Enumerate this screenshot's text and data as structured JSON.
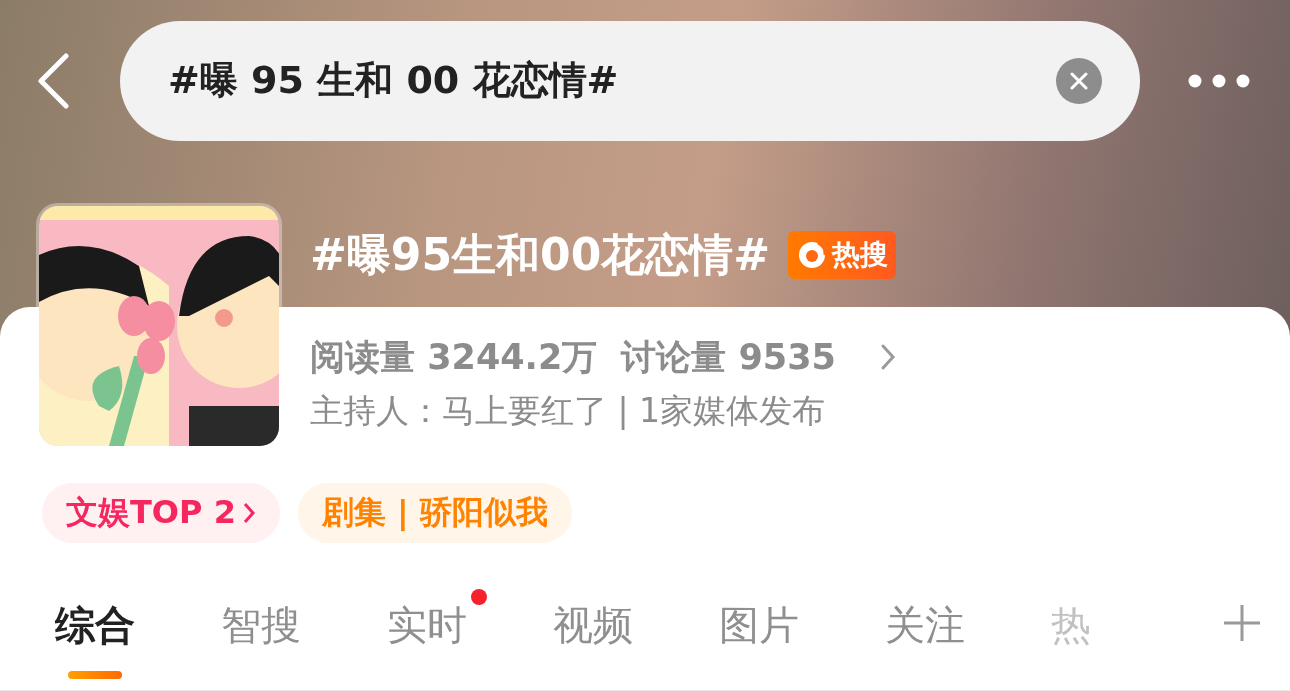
{
  "search": {
    "value": "#曝 95 生和 00 花恋情#"
  },
  "topic": {
    "title": "#曝95生和00花恋情#",
    "badge": "热搜"
  },
  "stats": [
    {
      "label": "阅读量",
      "value": "3244.2万"
    },
    {
      "label": "讨论量",
      "value": "9535"
    }
  ],
  "host_line": "主持人：马上要红了 | 1家媒体发布",
  "tags": [
    {
      "kind": "rank",
      "label": "文娱TOP 2"
    },
    {
      "kind": "category",
      "label": "剧集 | 骄阳似我"
    }
  ],
  "tabs": [
    {
      "label": "综合",
      "selected": true,
      "dot": false
    },
    {
      "label": "智搜",
      "selected": false,
      "dot": false
    },
    {
      "label": "实时",
      "selected": false,
      "dot": true
    },
    {
      "label": "视频",
      "selected": false,
      "dot": false
    },
    {
      "label": "图片",
      "selected": false,
      "dot": false
    },
    {
      "label": "关注",
      "selected": false,
      "dot": false
    },
    {
      "label": "热",
      "selected": false,
      "dot": false,
      "faded": true
    }
  ]
}
